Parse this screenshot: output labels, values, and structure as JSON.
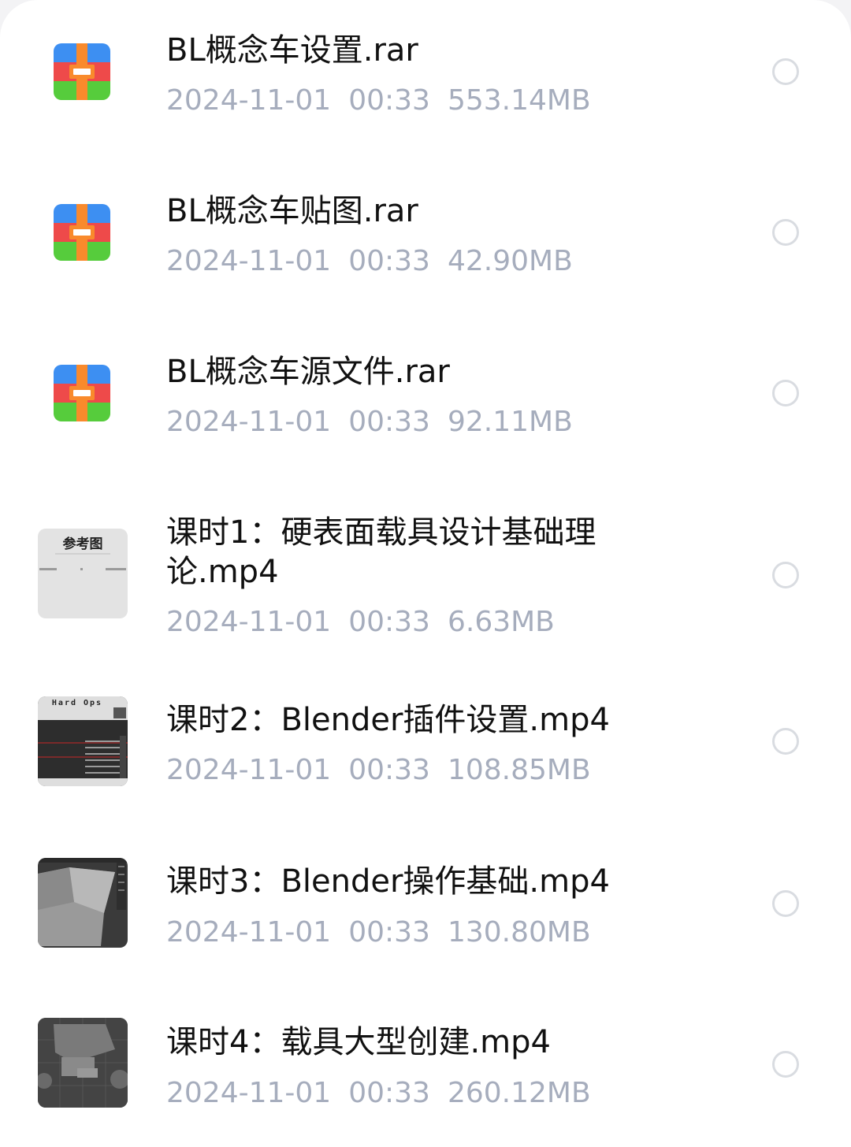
{
  "files": [
    {
      "name": "BL概念车设置.rar",
      "date": "2024-11-01",
      "time": "00:33",
      "size": "553.14MB",
      "icon": "rar-archive-icon",
      "selected": false
    },
    {
      "name": "BL概念车贴图.rar",
      "date": "2024-11-01",
      "time": "00:33",
      "size": "42.90MB",
      "icon": "rar-archive-icon",
      "selected": false
    },
    {
      "name": "BL概念车源文件.rar",
      "date": "2024-11-01",
      "time": "00:33",
      "size": "92.11MB",
      "icon": "rar-archive-icon",
      "selected": false
    },
    {
      "name": "课时1：硬表面载具设计基础理论.mp4",
      "date": "2024-11-01",
      "time": "00:33",
      "size": "6.63MB",
      "icon": "video-thumbnail",
      "thumb_text": "参考图",
      "selected": false
    },
    {
      "name": "课时2：Blender插件设置.mp4",
      "date": "2024-11-01",
      "time": "00:33",
      "size": "108.85MB",
      "icon": "video-thumbnail",
      "thumb_text": "Hard Ops",
      "selected": false
    },
    {
      "name": "课时3：Blender操作基础.mp4",
      "date": "2024-11-01",
      "time": "00:33",
      "size": "130.80MB",
      "icon": "video-thumbnail",
      "selected": false
    },
    {
      "name": "课时4：载具大型创建.mp4",
      "date": "2024-11-01",
      "time": "00:33",
      "size": "260.12MB",
      "icon": "video-thumbnail",
      "selected": false
    }
  ],
  "colors": {
    "rar_blue": "#3d8ff2",
    "rar_orange": "#f98a2c",
    "rar_red": "#ee4a4a",
    "rar_green": "#56cc3c",
    "meta_gray": "#a6adbd",
    "radio_border": "#d9dce1"
  }
}
